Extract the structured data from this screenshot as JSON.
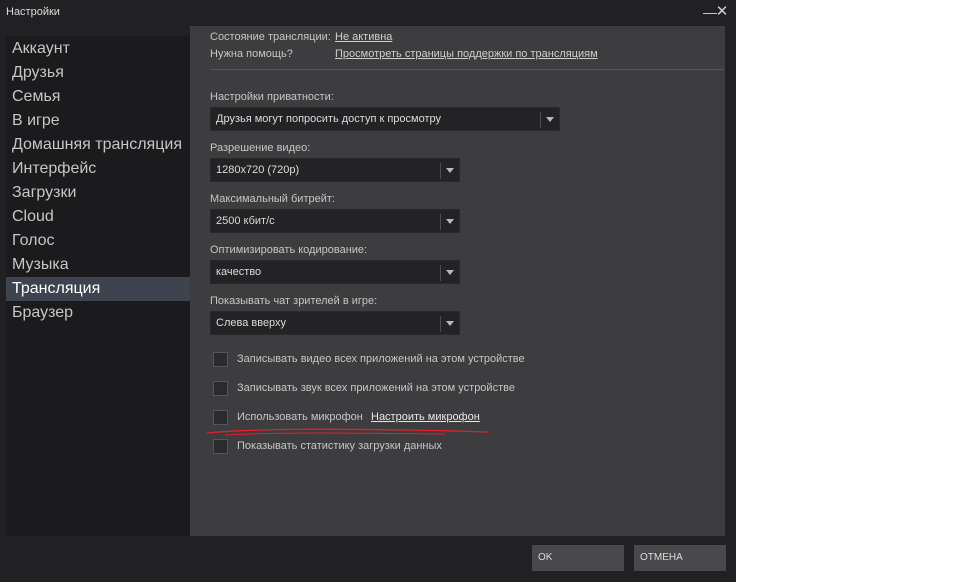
{
  "window": {
    "title": "Настройки",
    "minimize_icon": "minimize-icon",
    "close_icon": "close-icon",
    "close_glyph": "✕",
    "minimize_glyph": "—"
  },
  "sidebar": {
    "items": [
      {
        "label": "Аккаунт",
        "active": false
      },
      {
        "label": "Друзья",
        "active": false
      },
      {
        "label": "Семья",
        "active": false
      },
      {
        "label": "В игре",
        "active": false
      },
      {
        "label": "Домашняя трансляция",
        "active": false
      },
      {
        "label": "Интерфейс",
        "active": false
      },
      {
        "label": "Загрузки",
        "active": false
      },
      {
        "label": "Cloud",
        "active": false
      },
      {
        "label": "Голос",
        "active": false
      },
      {
        "label": "Музыка",
        "active": false
      },
      {
        "label": "Трансляция",
        "active": true
      },
      {
        "label": "Браузер",
        "active": false
      }
    ]
  },
  "broadcast": {
    "status_label": "Состояние трансляции:",
    "status_value": "Не активна",
    "help_label": "Нужна помощь?",
    "help_link": "Просмотреть страницы поддержки по трансляциям",
    "privacy": {
      "label": "Настройки приватности:",
      "value": "Друзья могут попросить доступ к просмотру"
    },
    "resolution": {
      "label": "Разрешение видео:",
      "value": "1280x720 (720p)"
    },
    "bitrate": {
      "label": "Максимальный битрейт:",
      "value": "2500 кбит/с"
    },
    "encoding": {
      "label": "Оптимизировать кодирование:",
      "value": "качество"
    },
    "chat": {
      "label": "Показывать чат зрителей в игре:",
      "value": "Слева вверху"
    },
    "checkboxes": {
      "record_video": {
        "label": "Записывать видео всех приложений на этом устройстве",
        "checked": false
      },
      "record_audio": {
        "label": "Записывать звук всех приложений на этом устройстве",
        "checked": false
      },
      "use_mic": {
        "label": "Использовать микрофон",
        "checked": false,
        "link": "Настроить микрофон"
      },
      "upload_stats": {
        "label": "Показывать статистику загрузки данных",
        "checked": false
      }
    }
  },
  "footer": {
    "ok_label": "OK",
    "cancel_label": "ОТМЕНА"
  },
  "colors": {
    "window_bg": "#212124",
    "content_bg": "#3d3d3f",
    "active_item_bg": "#3d4450",
    "annotation_red": "#e0202a"
  }
}
